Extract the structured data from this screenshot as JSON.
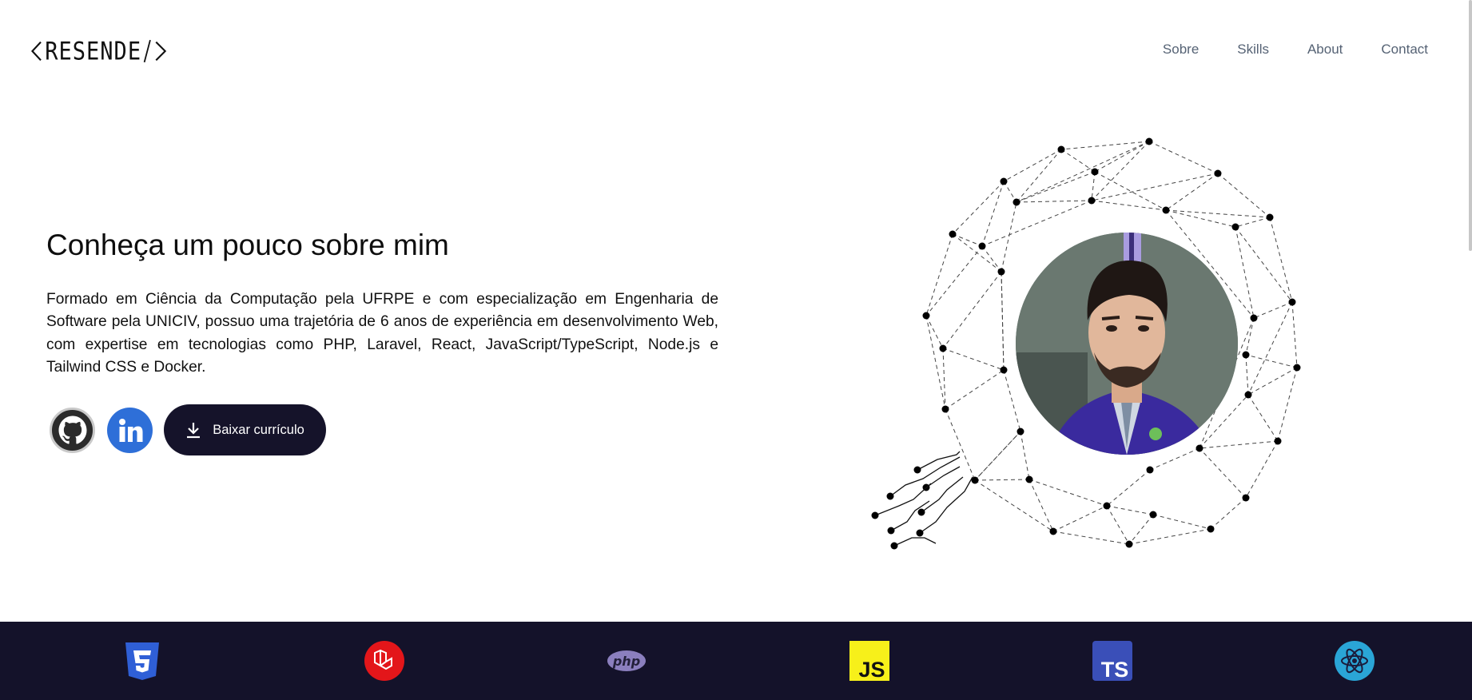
{
  "header": {
    "logo_text": "RESENDE",
    "nav": [
      {
        "label": "Sobre"
      },
      {
        "label": "Skills"
      },
      {
        "label": "About"
      },
      {
        "label": "Contact"
      }
    ]
  },
  "hero": {
    "title": "Conheça um pouco sobre mim",
    "description": "Formado em Ciência da Computação pela UFRPE e com especialização em Engenharia de Software pela UNICIV, possuo uma trajetória de 6 anos de experiência em desenvolvimento Web, com expertise em tecnologias como PHP, Laravel, React, JavaScript/TypeScript, Node.js e Tailwind CSS e Docker.",
    "download_label": "Baixar currículo",
    "socials": [
      {
        "name": "github",
        "icon": "github-icon"
      },
      {
        "name": "linkedin",
        "icon": "linkedin-icon"
      }
    ]
  },
  "tech_stack": [
    {
      "name": "CSS3",
      "icon": "css3-icon",
      "color": "#2f5fd6"
    },
    {
      "name": "Laravel",
      "icon": "laravel-icon",
      "color": "#e3161a"
    },
    {
      "name": "PHP",
      "icon": "php-icon",
      "color": "#8b7fbe"
    },
    {
      "name": "JavaScript",
      "icon": "javascript-icon",
      "color": "#f7f01a",
      "text": "JS"
    },
    {
      "name": "TypeScript",
      "icon": "typescript-icon",
      "color": "#3a4fb8",
      "text": "TS"
    },
    {
      "name": "React",
      "icon": "react-icon",
      "color": "#2aa5d6"
    }
  ],
  "colors": {
    "nav_text": "#556274",
    "button_bg": "#15132a",
    "footer_bg": "#14122a"
  }
}
